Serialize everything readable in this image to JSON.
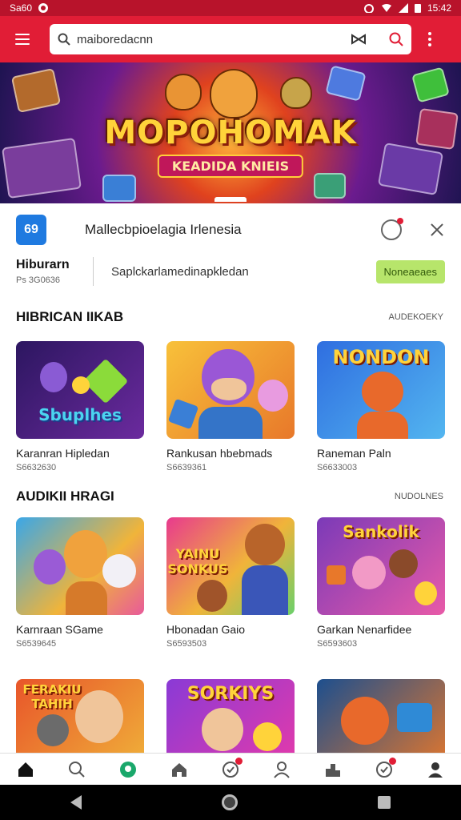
{
  "status_bar": {
    "left_text": "Sa60",
    "time": "15:42"
  },
  "toolbar": {
    "search_value": "maiboredacnn"
  },
  "banner": {
    "title": "MOPOHOMAK",
    "subtitle": "KEADIDA KNIEIS"
  },
  "info": {
    "icon_text": "69",
    "title": "Mallecbpioelagia Irlenesia"
  },
  "category": {
    "title": "Hiburarn",
    "sub": "Ps 3G0636",
    "desc": "Saplckarlamedinapkledan",
    "button": "Noneaeaes"
  },
  "sections": [
    {
      "title": "HIBRICAN IIKAB",
      "link": "AUDEKOEKY",
      "cards": [
        {
          "title": "Karanran Hipledan",
          "sub": "S6632630",
          "art": "Sbuplhes"
        },
        {
          "title": "Rankusan hbebmads",
          "sub": "S6639361",
          "art": ""
        },
        {
          "title": "Raneman Paln",
          "sub": "S6633003",
          "art": "NONDON"
        }
      ]
    },
    {
      "title": "AUDIKII HRAGI",
      "link": "NUDOLNES",
      "cards": [
        {
          "title": "Karnraan SGame",
          "sub": "S6539645",
          "art": ""
        },
        {
          "title": "Hbonadan Gaio",
          "sub": "S6593503",
          "art": "YAINU SONKUS"
        },
        {
          "title": "Garkan Nenarfidee",
          "sub": "S6593603",
          "art": "Sankolik"
        }
      ]
    },
    {
      "title": "",
      "link": "",
      "cards": [
        {
          "title": "",
          "sub": "",
          "art": "FERAKIU TAHIH"
        },
        {
          "title": "",
          "sub": "",
          "art": "SORKIYS"
        },
        {
          "title": "",
          "sub": "",
          "art": ""
        }
      ]
    }
  ],
  "colors": {
    "brand": "#e11d36",
    "accent_green": "#b7e56b"
  },
  "icons": [
    "menu-icon",
    "search-icon",
    "bowtie-icon",
    "kebab-icon",
    "bell-icon",
    "close-icon",
    "home-icon",
    "search-nav-icon",
    "games-icon",
    "store-icon",
    "badge-icon",
    "profile-icon"
  ]
}
